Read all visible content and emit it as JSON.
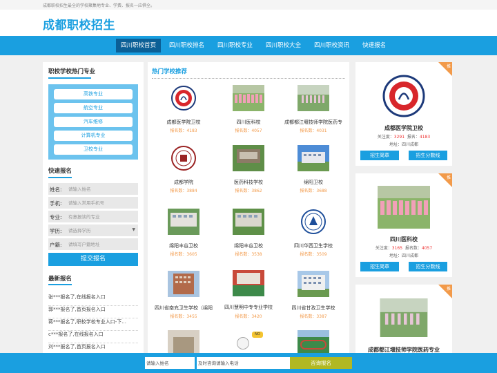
{
  "topbar": {
    "text": "成都职校招生最全的学校聚集地专业、学费、报名一应俱全。"
  },
  "header": {
    "logo": "成都职校招生"
  },
  "nav": [
    "四川职校首页",
    "四川职校排名",
    "四川职校专业",
    "四川职校大全",
    "四川职校资讯",
    "快速报名"
  ],
  "majors": {
    "title": "职校学校热门专业",
    "items": [
      "高铁专业",
      "航空专业",
      "汽车维修",
      "计算机专业",
      "卫校专业"
    ]
  },
  "signup": {
    "title": "快速报名",
    "fields": [
      {
        "label": "姓名:",
        "placeholder": "请输入姓名"
      },
      {
        "label": "手机:",
        "placeholder": "请输入常用手机号"
      },
      {
        "label": "专业:",
        "placeholder": "有意报读的专业"
      },
      {
        "label": "学历:",
        "placeholder": "请选择学历"
      },
      {
        "label": "户籍:",
        "placeholder": "请填写户籍地址"
      }
    ],
    "submit": "提交报名"
  },
  "latest": {
    "title": "最新报名",
    "items": [
      "张***报名了,在线报名入口",
      "郭***报名了,首页报名入口",
      "蒋***报名了,职校学校专业入口-下...",
      "c***报名了,在线报名入口",
      "刘***报名了,首页报名入口"
    ]
  },
  "hot": {
    "title": "热门学校推荐",
    "schools": [
      {
        "name": "成都医学院卫校",
        "count": "报名数：4183"
      },
      {
        "name": "四川医科校",
        "count": "报名数：4057"
      },
      {
        "name": "成都都江堰技师学院医药专",
        "count": "报名数：4031"
      },
      {
        "name": "成都学院",
        "count": "报名数：3884"
      },
      {
        "name": "医药科技学校",
        "count": "报名数：3862"
      },
      {
        "name": "绵阳卫校",
        "count": "报名数：3688"
      },
      {
        "name": "绵阳丰谷卫校",
        "count": "报名数：3605"
      },
      {
        "name": "绵阳丰谷卫校",
        "count": "报名数：3538"
      },
      {
        "name": "四川华西卫生学校",
        "count": "报名数：3509"
      },
      {
        "name": "四川省南充卫生学校（绵阳",
        "count": "报名数：3455"
      },
      {
        "name": "四川慧明中专专业学校",
        "count": "报名数：3420"
      },
      {
        "name": "四川省甘孜卫生学校",
        "count": "报名数：3387"
      }
    ]
  },
  "cards": [
    {
      "ribbon": "推",
      "name": "成都医学院卫校",
      "attention_label": "关注度：",
      "attention": "3291",
      "signup_label": "报名：",
      "signups": "4183",
      "address": "地址：四川成都",
      "btn1": "招生简章",
      "btn2": "招生分数线"
    },
    {
      "ribbon": "推",
      "name": "四川医科校",
      "attention_label": "关注度：",
      "attention": "3165",
      "signup_label": "报名数：",
      "signups": "4057",
      "address": "地址：四川成都",
      "btn1": "招生简章",
      "btn2": "招生分数线"
    },
    {
      "ribbon": "推",
      "name": "成都都江堰技师学院医药专业"
    }
  ],
  "bottom": {
    "name_placeholder": "请输入姓名",
    "phone_placeholder": "及时咨询请输入电话",
    "button": "咨询报名"
  },
  "colors": {
    "primary": "#1a9fe0",
    "nav_active": "#0b5f96",
    "count_orange": "#f29a4a",
    "submit_olive": "#b1b823"
  }
}
